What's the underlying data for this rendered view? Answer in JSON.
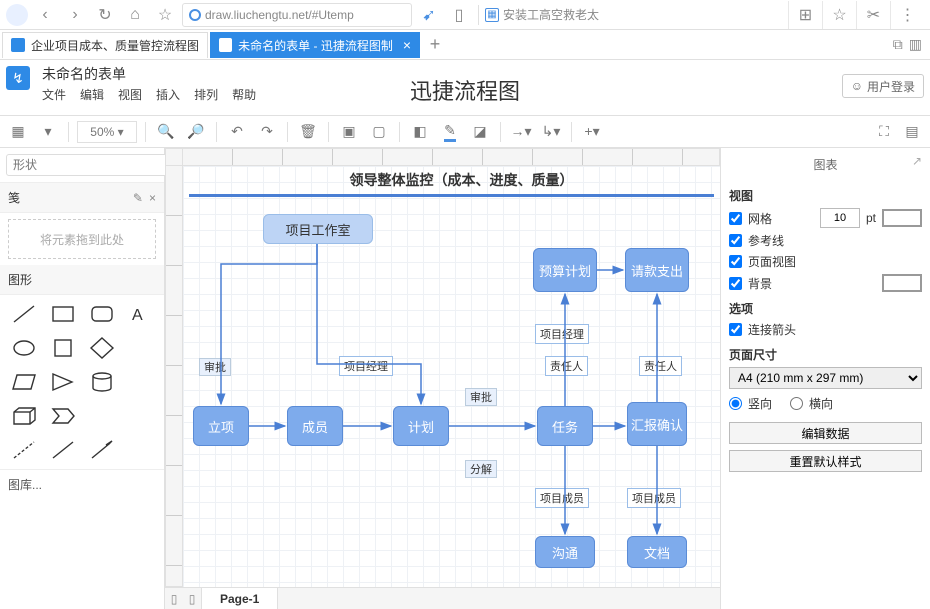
{
  "browser": {
    "url": "draw.liuchengtu.net/#Utemp",
    "side_link": "安装工高空救老太",
    "tabs": [
      {
        "label": "企业项目成本、质量管控流程图",
        "active": false
      },
      {
        "label": "未命名的表单 - 迅捷流程图制",
        "active": true
      }
    ]
  },
  "app": {
    "doc_title": "未命名的表单",
    "title": "迅捷流程图",
    "login_label": "用户登录",
    "menus": [
      "文件",
      "编辑",
      "视图",
      "插入",
      "排列",
      "帮助"
    ]
  },
  "toolbar": {
    "zoom": "50%"
  },
  "left": {
    "search_placeholder": "形状",
    "clipboard_title": "笺",
    "drop_hint": "将元素拖到此处",
    "shapes_title": "图形",
    "more_label": "图库..."
  },
  "canvas": {
    "banner": "领导整体监控（成本、进度、质量）",
    "nodes": {
      "workshop": "项目工作室",
      "lixiang": "立项",
      "chengyuan": "成员",
      "jihua": "计划",
      "renwu": "任务",
      "huibao": "汇报确认",
      "yusuan": "预算计划",
      "qingkuan": "请款支出",
      "goutong": "沟通",
      "wendang": "文档"
    },
    "labels": {
      "pm1": "项目经理",
      "pm2": "项目经理",
      "zeren1": "责任人",
      "zeren2": "责任人",
      "chengyuan1": "项目成员",
      "chengyuan2": "项目成员",
      "shenpi1": "审批",
      "shenpi2": "审批",
      "fenjie": "分解"
    },
    "page_tab": "Page-1"
  },
  "right": {
    "panel_title": "图表",
    "view_section": "视图",
    "grid_label": "网格",
    "grid_value": "10",
    "grid_unit": "pt",
    "guides_label": "参考线",
    "pageview_label": "页面视图",
    "background_label": "背景",
    "options_section": "选项",
    "arrows_label": "连接箭头",
    "pagesize_section": "页面尺寸",
    "pagesize_value": "A4 (210 mm x 297 mm)",
    "orient_portrait": "竖向",
    "orient_landscape": "横向",
    "edit_data_btn": "编辑数据",
    "reset_style_btn": "重置默认样式"
  }
}
